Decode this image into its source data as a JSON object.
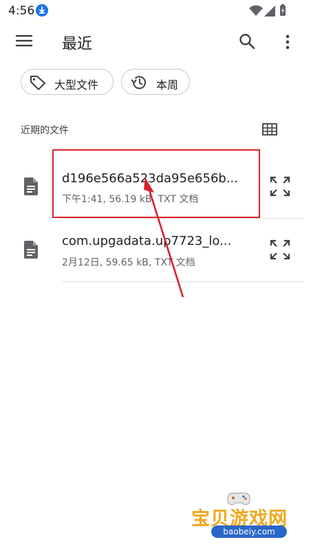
{
  "status_bar": {
    "time": "4:56"
  },
  "toolbar": {
    "title": "最近"
  },
  "chips": [
    {
      "label": "大型文件",
      "icon": "tag-icon"
    },
    {
      "label": "本周",
      "icon": "history-icon"
    }
  ],
  "section": {
    "title": "近期的文件"
  },
  "files": [
    {
      "name": "d196e566a523da95e656b...",
      "meta": "下午1:41, 56.19 kB, TXT 文档",
      "icon": "document-icon"
    },
    {
      "name": "com.upgadata.up7723_lo...",
      "meta": "2月12日, 59.65 kB, TXT 文档",
      "icon": "document-icon"
    }
  ],
  "watermark": {
    "text": "宝贝游戏网",
    "url": "baobeiy.com"
  },
  "colors": {
    "annotation": "#d7222c",
    "accent": "#1a73e8",
    "watermark": "#f2a81d"
  }
}
